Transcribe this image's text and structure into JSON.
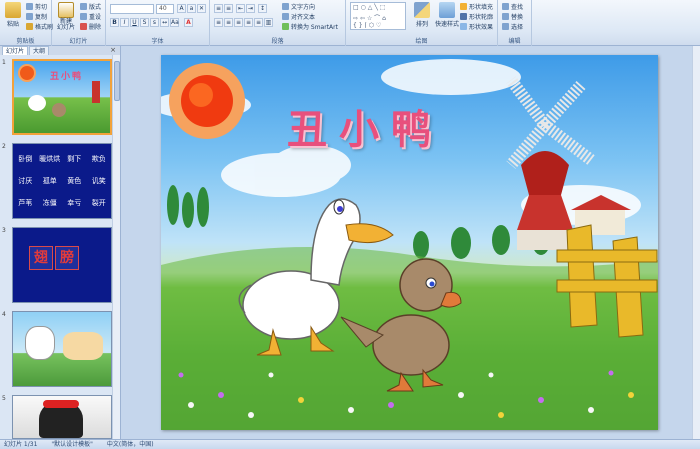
{
  "ribbon": {
    "clipboard": {
      "label": "剪贴板",
      "paste": "粘贴",
      "cut": "剪切",
      "copy": "复制",
      "format_painter": "格式刷"
    },
    "slides": {
      "label": "幻灯片",
      "new_slide": "新建\n幻灯片",
      "layout": "版式",
      "reset": "重设",
      "delete": "删除"
    },
    "font": {
      "label": "字体",
      "font_name": "",
      "font_size": "40"
    },
    "paragraph": {
      "label": "段落",
      "text_direction": "文字方向",
      "align_text": "对齐文本",
      "smartart": "转换为 SmartArt"
    },
    "drawing": {
      "label": "绘图",
      "arrange": "排列",
      "quick_styles": "快速样式",
      "shape_fill": "形状填充",
      "shape_outline": "形状轮廓",
      "shape_effects": "形状效果"
    },
    "editing": {
      "label": "编辑",
      "find": "查找",
      "replace": "替换",
      "select": "选择"
    }
  },
  "panel": {
    "tab_slides": "幻灯片",
    "tab_outline": "大纲",
    "close": "×",
    "thumbs": [
      {
        "num": "1"
      },
      {
        "num": "2",
        "words": [
          "卧倒",
          "暖烘烘",
          "剩下",
          "欺负",
          "讨厌",
          "孤单",
          "黄色",
          "讥笑",
          "芦苇",
          "冻僵",
          "幸亏",
          "裂开"
        ]
      },
      {
        "num": "3",
        "chars": [
          "翅",
          "膀"
        ]
      },
      {
        "num": "4"
      },
      {
        "num": "5"
      }
    ]
  },
  "slide": {
    "title": "丑小鸭"
  },
  "status": {
    "slide_info": "幻灯片 1/31",
    "theme": "\"默认设计模板\"",
    "language": "中文(简体，中国)"
  },
  "colors": {
    "title_pink": "#e8507d",
    "ribbon_blue": "#dde8f5",
    "selection": "#f2a23a"
  }
}
